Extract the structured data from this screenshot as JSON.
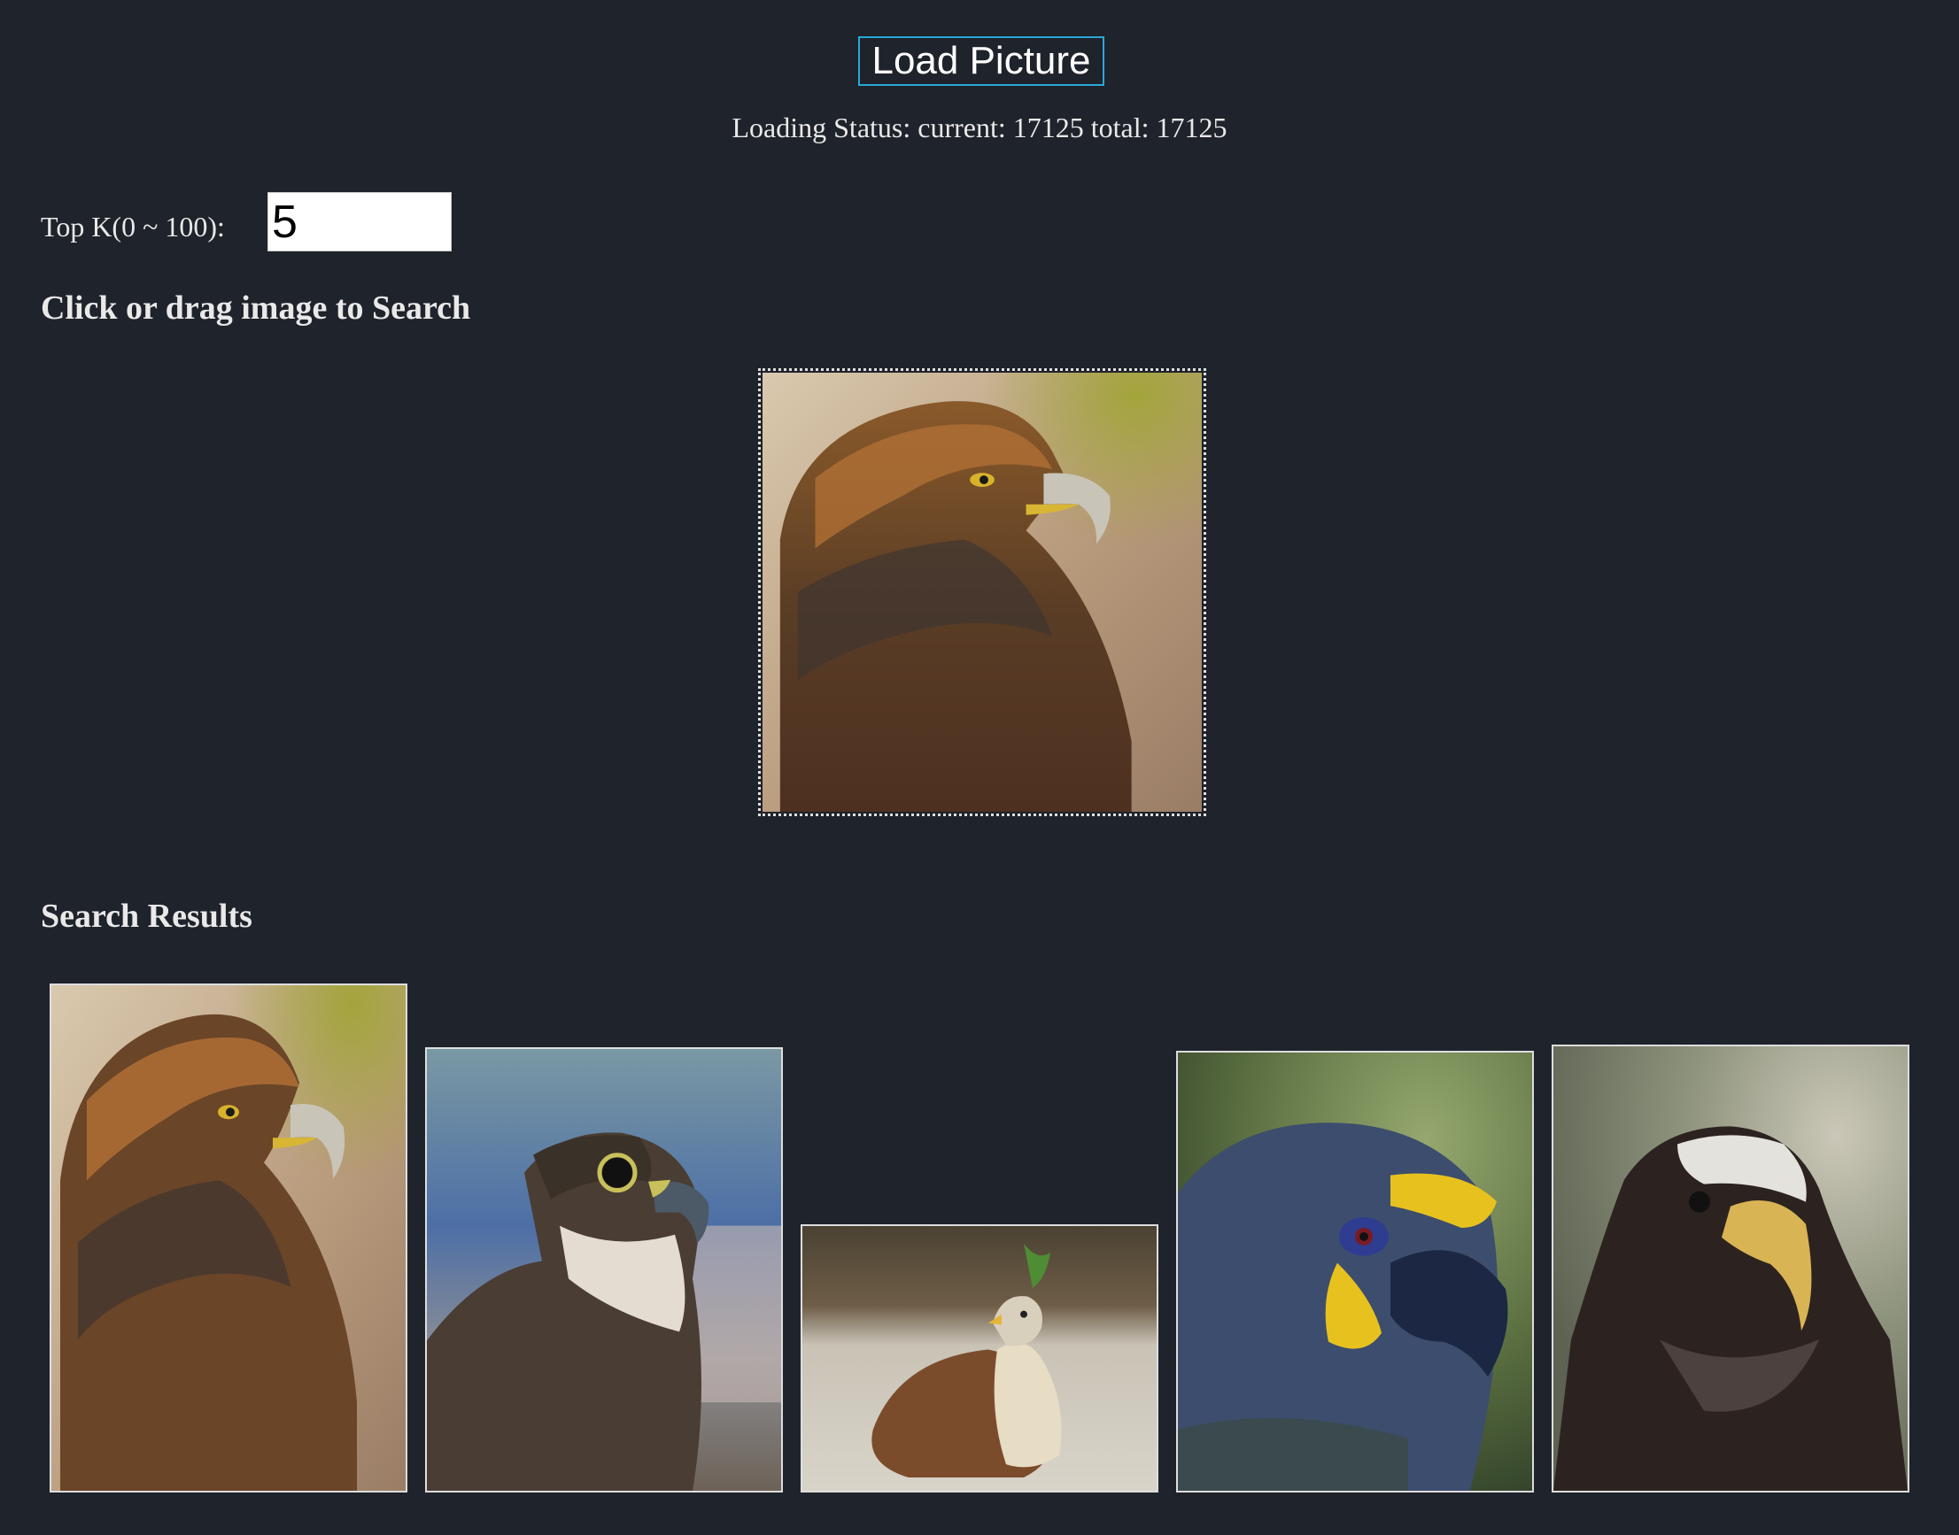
{
  "load_button": {
    "label": "Load Picture"
  },
  "status": {
    "text": "Loading Status: current: 17125 total: 17125"
  },
  "topk": {
    "label": "Top K(0 ~ 100):",
    "value": "5"
  },
  "search_heading": "Click or drag image to Search",
  "query_image": {
    "subject": "golden-eagle"
  },
  "results_heading": "Search Results",
  "results": [
    {
      "subject": "golden-eagle"
    },
    {
      "subject": "falcon"
    },
    {
      "subject": "hawk-on-gravel"
    },
    {
      "subject": "parrot-blue-yellow"
    },
    {
      "subject": "dark-eagle"
    }
  ],
  "colors": {
    "background": "#1f232b",
    "accent_border": "#2aa8d8",
    "text": "#e9e9e9"
  }
}
